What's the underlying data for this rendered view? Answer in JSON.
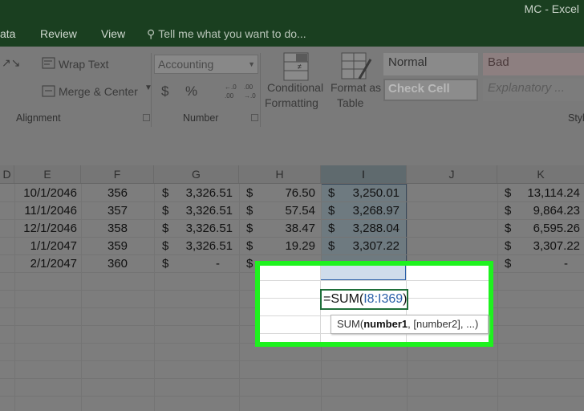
{
  "window": {
    "title": "MC - Excel"
  },
  "ribbon_tabs": [
    {
      "label": "ata"
    },
    {
      "label": "Review"
    },
    {
      "label": "View"
    }
  ],
  "tell_me": {
    "placeholder": "Tell me what you want to do..."
  },
  "ribbon": {
    "alignment": {
      "wrap_text": "Wrap Text",
      "merge_center": "Merge & Center",
      "group_label": "Alignment"
    },
    "number": {
      "format_value": "Accounting",
      "currency": "$",
      "percent": "%",
      "group_label": "Number"
    },
    "styles_cmds": {
      "conditional": [
        "Conditional",
        "Formatting"
      ],
      "format_as": [
        "Format as",
        "Table"
      ]
    },
    "cell_styles": {
      "normal": "Normal",
      "bad": "Bad",
      "check_cell": "Check Cell",
      "explanatory": "Explanatory ...",
      "group_label_partial": "Styl"
    }
  },
  "columns": [
    "D",
    "E",
    "F",
    "G",
    "H",
    "I",
    "J",
    "K"
  ],
  "selected_column": "I",
  "rows": [
    {
      "E": "10/1/2046",
      "F": "356",
      "G": "3,326.51",
      "H": "76.50",
      "I": "3,250.01",
      "K": "13,114.24"
    },
    {
      "E": "11/1/2046",
      "F": "357",
      "G": "3,326.51",
      "H": "57.54",
      "I": "3,268.97",
      "K": "9,864.23"
    },
    {
      "E": "12/1/2046",
      "F": "358",
      "G": "3,326.51",
      "H": "38.47",
      "I": "3,288.04",
      "K": "6,595.26"
    },
    {
      "E": "1/1/2047",
      "F": "359",
      "G": "3,326.51",
      "H": "19.29",
      "I": "3,307.22",
      "K": "3,307.22"
    },
    {
      "E": "2/1/2047",
      "F": "360",
      "G": "-",
      "K": "-"
    }
  ],
  "currency_symbol": "$",
  "formula_entry": {
    "prefix": "=SUM(",
    "range": "I8:I369",
    "suffix": ")"
  },
  "tooltip": {
    "fn": "SUM(",
    "arg1": "number1",
    "rest": ", [number2], ...)"
  },
  "colors": {
    "highlight": "#1ef21e",
    "title_bar": "#1a3f20",
    "range_ref": "#2a5fa8"
  }
}
